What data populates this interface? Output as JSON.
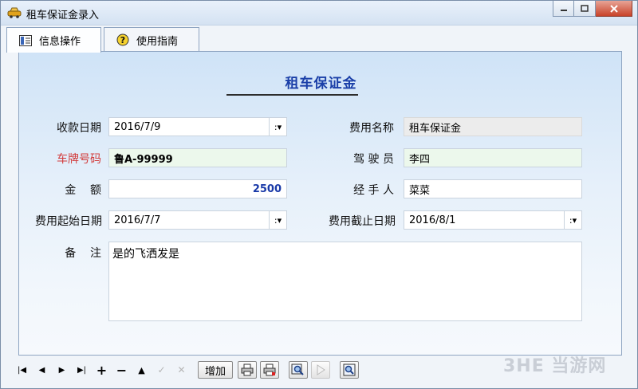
{
  "window": {
    "title": "租车保证金录入",
    "tabs": [
      {
        "label": "信息操作",
        "icon": "list-icon",
        "active": true
      },
      {
        "label": "使用指南",
        "icon": "help-icon",
        "active": false
      }
    ]
  },
  "form": {
    "title": "租车保证金",
    "receipt_date": {
      "label": "收款日期",
      "value": "2016/7/9"
    },
    "fee_name": {
      "label": "费用名称",
      "value": "租车保证金"
    },
    "plate": {
      "label": "车牌号码",
      "value": "鲁A-99999"
    },
    "driver": {
      "label": "驾 驶 员",
      "value": "李四"
    },
    "amount": {
      "label": "金    额",
      "value": "2500"
    },
    "handler": {
      "label": "经 手 人",
      "value": "菜菜"
    },
    "start_date": {
      "label": "费用起始日期",
      "value": "2016/7/7"
    },
    "end_date": {
      "label": "费用截止日期",
      "value": "2016/8/1"
    },
    "note": {
      "label": "备    注",
      "value": "是的飞洒发是"
    }
  },
  "toolbar": {
    "first": "|◀",
    "prev": "◀",
    "next": "▶",
    "last": "▶|",
    "insert": "+",
    "delete": "−",
    "edit": "▲",
    "post": "✓",
    "cancel": "✕",
    "add_label": "增加"
  },
  "watermark": "3HE 当游网",
  "colors": {
    "title": "#1a3fa8",
    "required_label": "#d23b3b",
    "amount": "#1a3aa8",
    "highlight_field": "#ecf8ec"
  }
}
